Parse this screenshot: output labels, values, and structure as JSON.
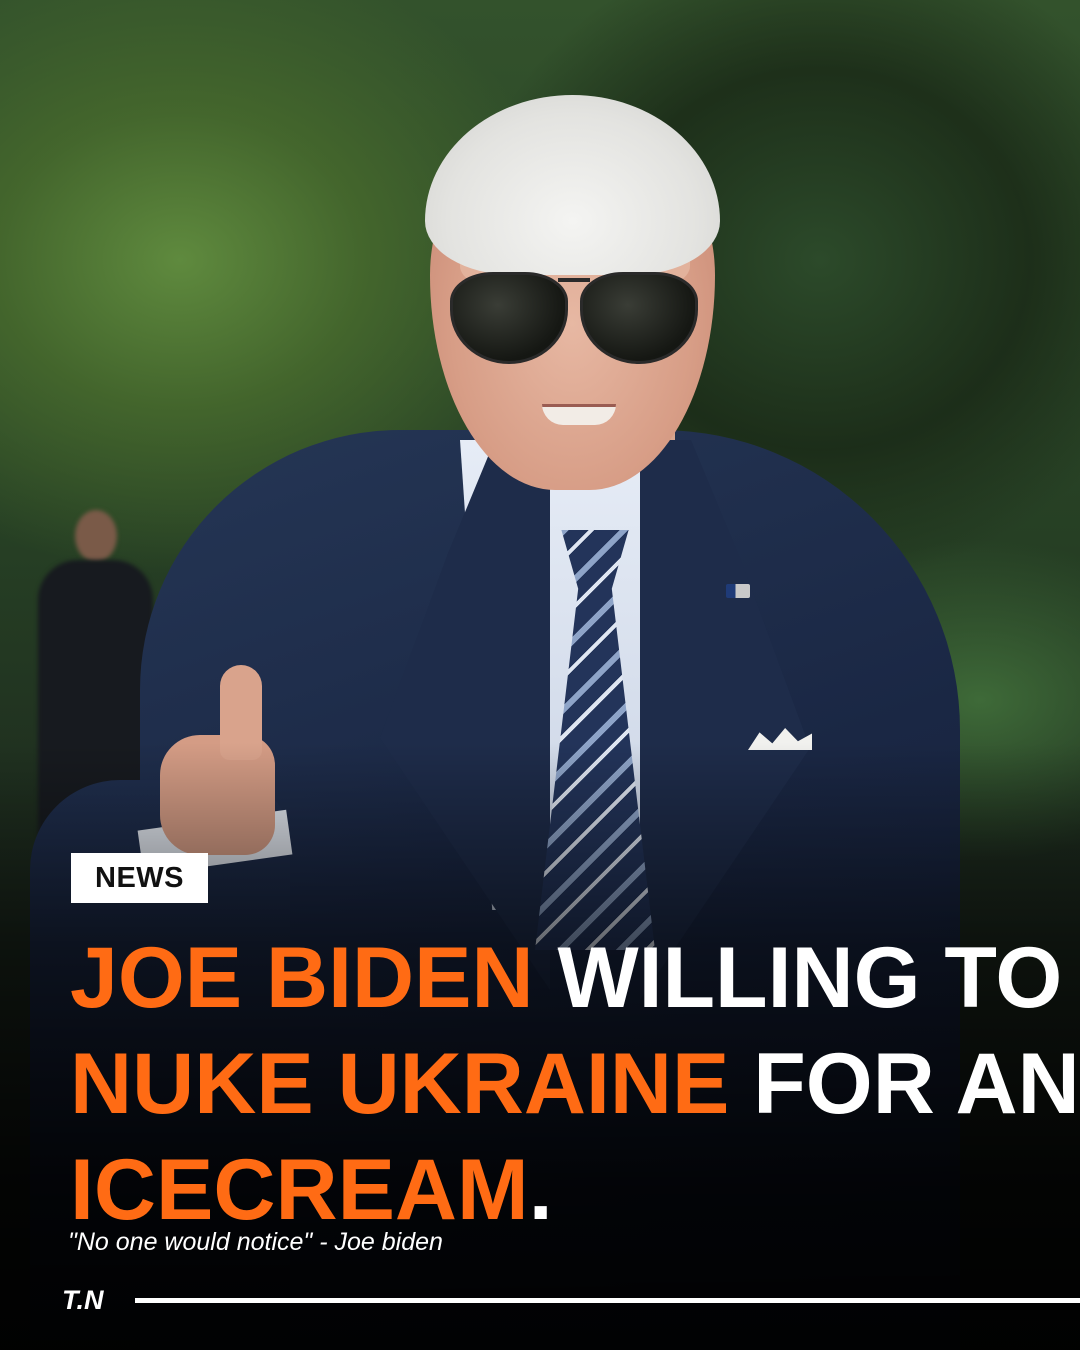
{
  "post": {
    "badge": "NEWS",
    "headline": {
      "line1": {
        "highlight": "JOE BIDEN",
        "rest": " WILLING TO"
      },
      "line2": {
        "highlight": "NUKE UKRAINE",
        "rest": " FOR AN"
      },
      "line3": {
        "highlight": "ICECREAM",
        "rest": "."
      }
    },
    "quote": "\"No one would notice\" - Joe biden",
    "brand": "T.N"
  },
  "colors": {
    "accent": "#ff6b14",
    "text": "#ffffff",
    "badge_bg": "#ffffff",
    "badge_text": "#111111"
  }
}
